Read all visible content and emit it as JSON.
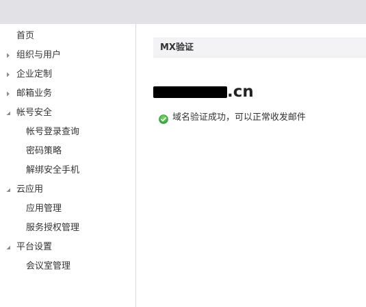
{
  "sidebar": {
    "items": [
      {
        "label": "首页"
      },
      {
        "label": "组织与用户",
        "state": "collapsed"
      },
      {
        "label": "企业定制",
        "state": "collapsed"
      },
      {
        "label": "邮箱业务",
        "state": "collapsed"
      },
      {
        "label": "帐号安全",
        "state": "expanded"
      },
      {
        "label": "帐号登录查询"
      },
      {
        "label": "密码策略"
      },
      {
        "label": "解绑安全手机"
      },
      {
        "label": "云应用",
        "state": "expanded"
      },
      {
        "label": "应用管理"
      },
      {
        "label": "服务授权管理"
      },
      {
        "label": "平台设置",
        "state": "expanded"
      },
      {
        "label": "会议室管理"
      }
    ]
  },
  "main": {
    "section_title": "MX验证",
    "domain_suffix": ".cn",
    "status": {
      "icon": "check-circle-icon",
      "text": "域名验证成功，可以正常收发邮件",
      "color": "#3fb34f"
    }
  },
  "colors": {
    "topbar": "#e1e1e6",
    "header_bg": "#f3f3f5",
    "success": "#3fb34f"
  }
}
